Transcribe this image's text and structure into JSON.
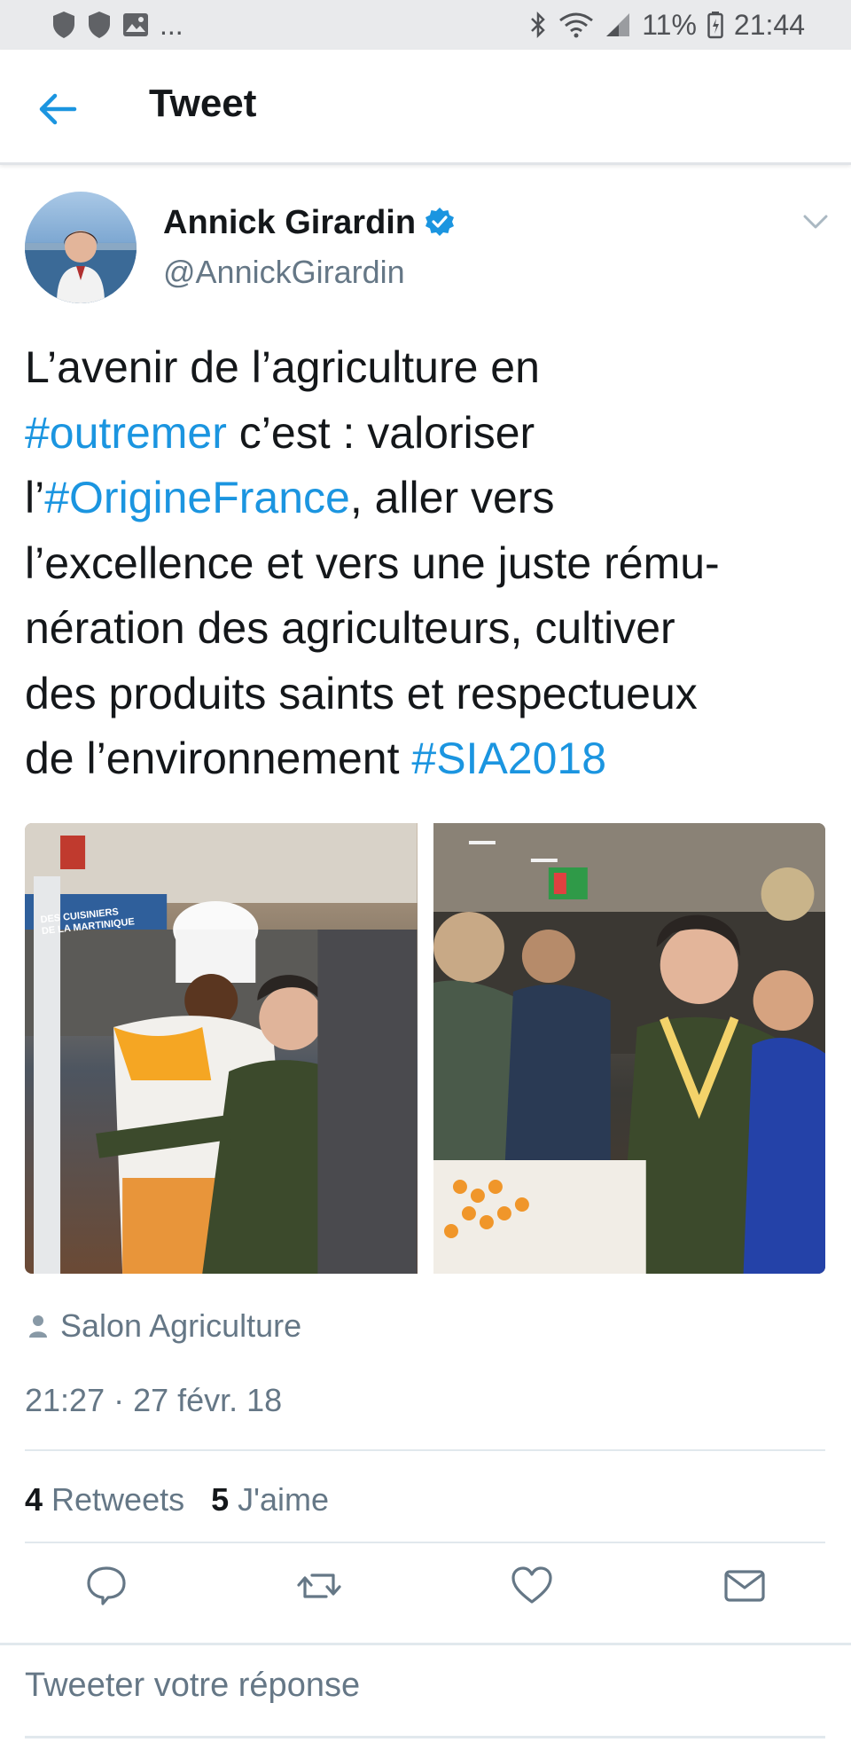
{
  "status_bar": {
    "overflow": "...",
    "battery_percent": "11%",
    "time": "21:44",
    "icons": [
      "shield-icon",
      "shield-icon",
      "image-icon",
      "bluetooth-icon",
      "wifi-icon",
      "signal-icon",
      "battery-icon"
    ]
  },
  "header": {
    "title": "Tweet",
    "back_icon": "back-arrow-icon"
  },
  "tweet": {
    "author": {
      "name": "Annick Girardin",
      "handle": "@AnnickGirardin",
      "verified": true
    },
    "text": {
      "line1": "L’avenir de l’agriculture en",
      "tag_outremer": "#outremer",
      "after_outremer": " c’est : valoriser",
      "before_origine": "l’",
      "tag_origine": "#OrigineFrance",
      "after_origine": ", aller vers",
      "line4": "l’excellence et vers une juste rému-",
      "line5": "nération des agriculteurs, cultiver",
      "line6": "des produits saints et respectueux",
      "before_sia": "de l’environnement ",
      "tag_sia": "#SIA2018"
    },
    "media": {
      "photo1_banner": "DES CUISINIERS\nDE LA MARTINIQUE"
    },
    "location": "Salon Agriculture",
    "timestamp": "21:27 · 27 févr. 18",
    "stats": {
      "retweets_count": "4",
      "retweets_label": "Retweets",
      "likes_count": "5",
      "likes_label": "J'aime"
    },
    "actions": [
      "reply-icon",
      "retweet-icon",
      "like-icon",
      "message-icon"
    ]
  },
  "reply": {
    "placeholder": "Tweeter votre réponse"
  },
  "colors": {
    "accent": "#1b95e0",
    "text": "#14171a",
    "secondary": "#657786",
    "divider": "#e1e8ed",
    "status_bar": "#e9eaec"
  }
}
